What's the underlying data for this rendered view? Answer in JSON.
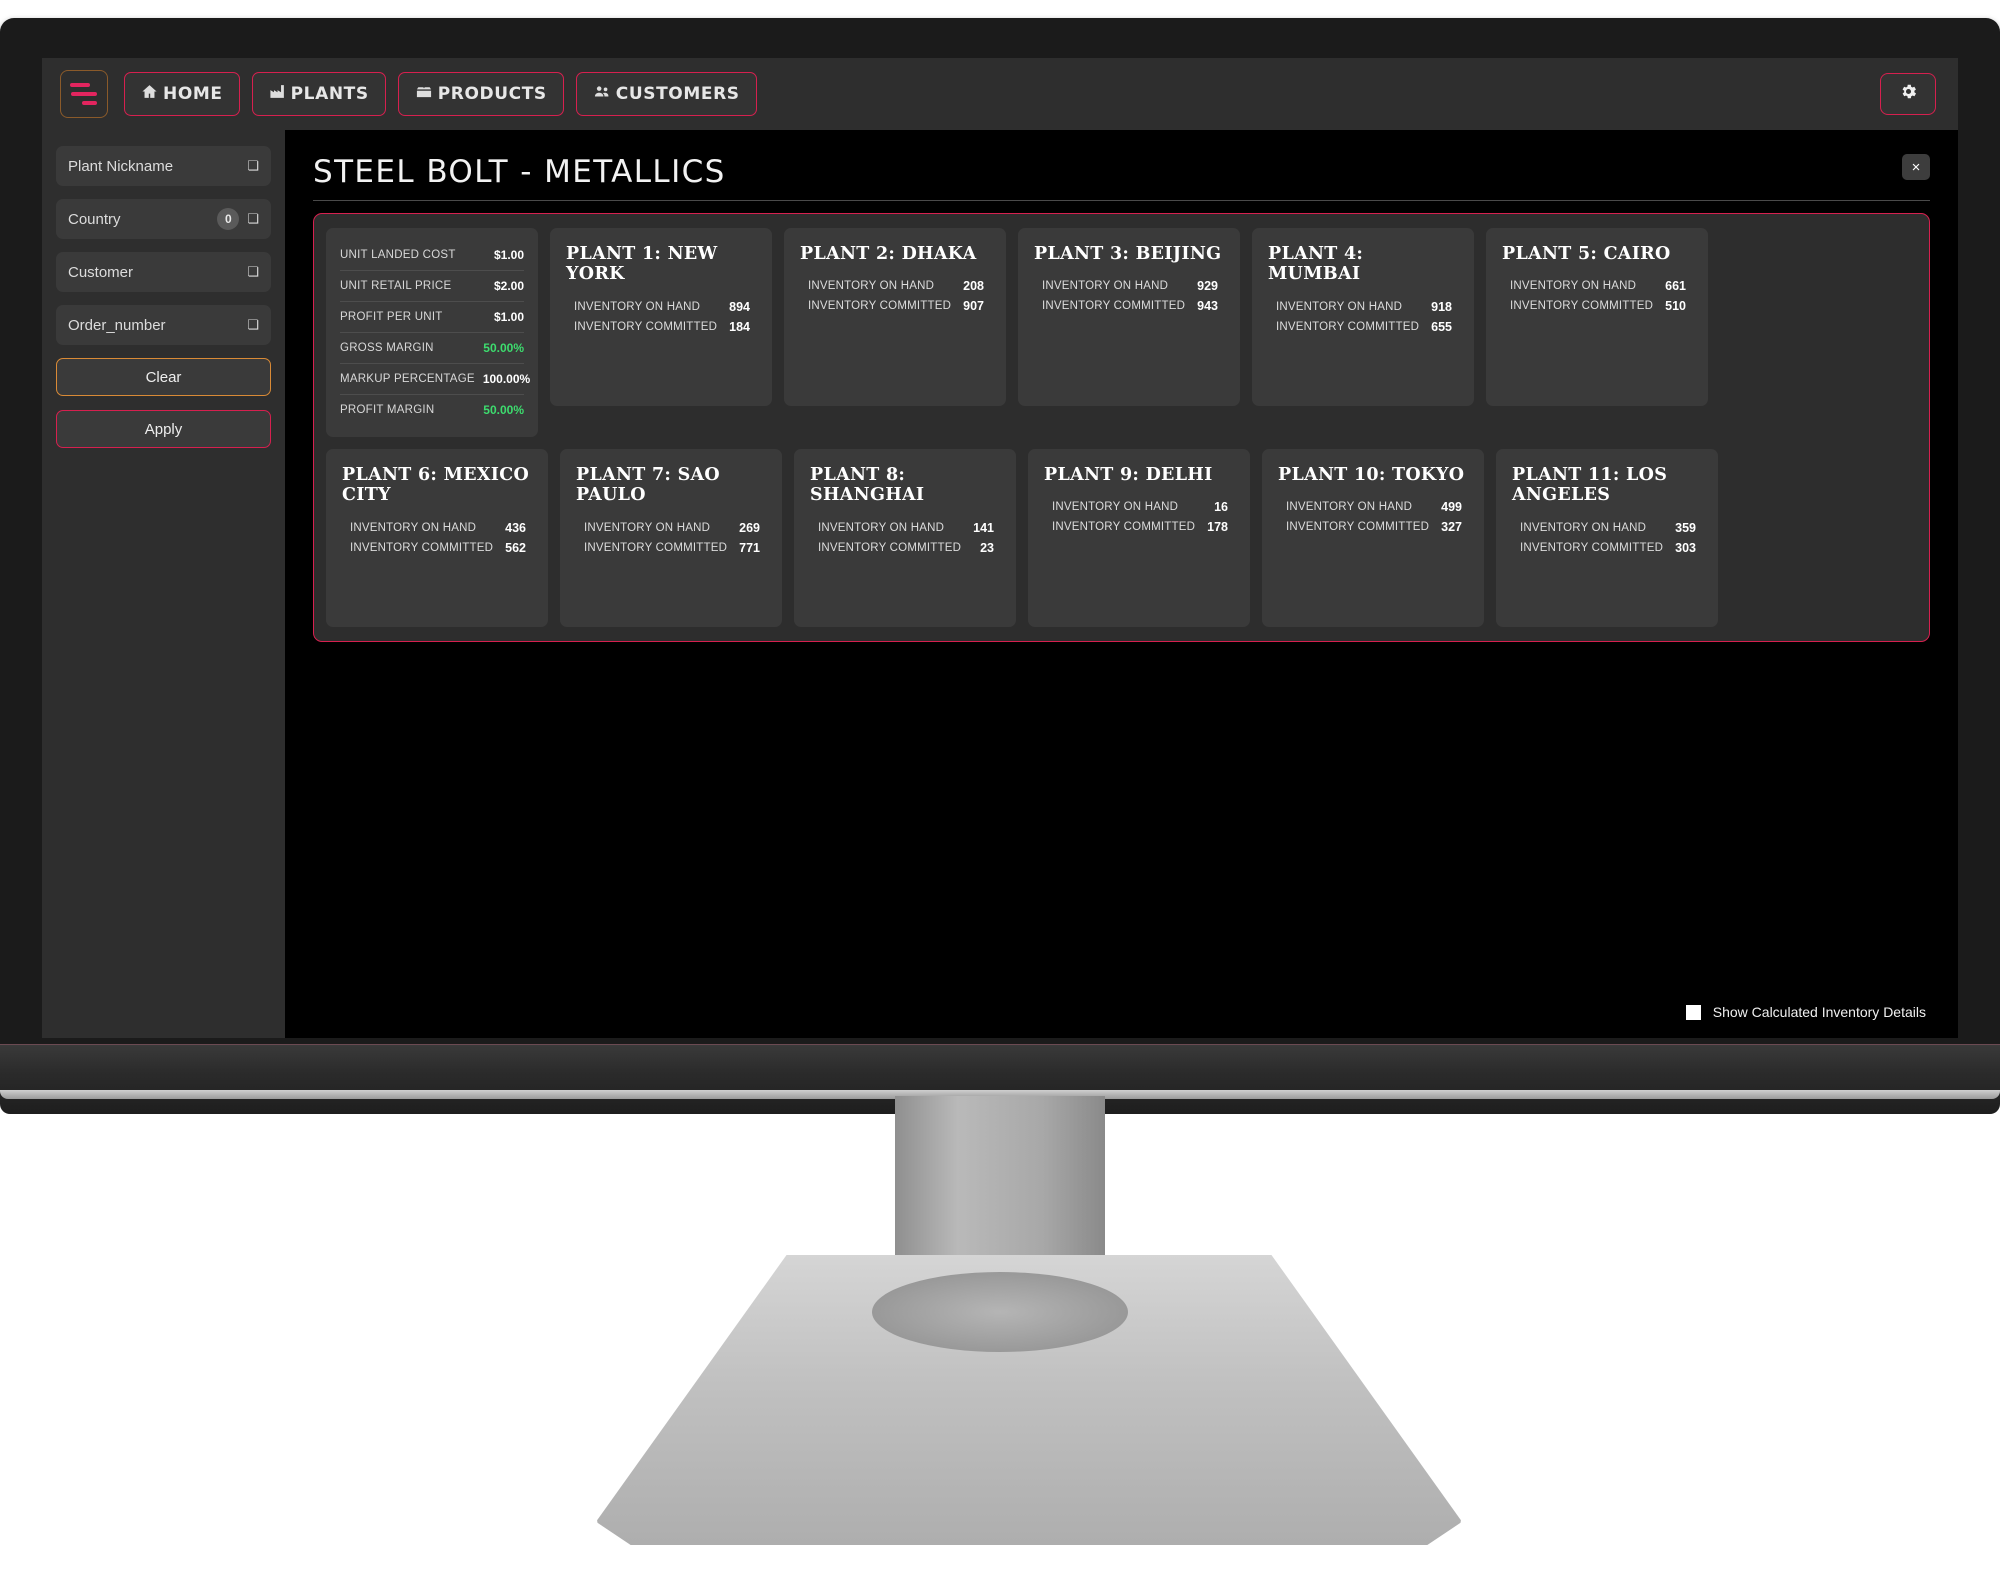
{
  "nav": {
    "brand_icon": "filter-menu-icon",
    "items": [
      {
        "label": "HOME",
        "icon": "home-icon"
      },
      {
        "label": "PLANTS",
        "icon": "factory-icon"
      },
      {
        "label": "PRODUCTS",
        "icon": "box-icon"
      },
      {
        "label": "CUSTOMERS",
        "icon": "people-icon"
      }
    ],
    "settings_icon": "gear-icon"
  },
  "sidebar": {
    "filters": [
      {
        "label": "Plant Nickname",
        "badge": null
      },
      {
        "label": "Country",
        "badge": "0"
      },
      {
        "label": "Customer",
        "badge": null
      },
      {
        "label": "Order_number",
        "badge": null
      }
    ],
    "clear_label": "Clear",
    "apply_label": "Apply"
  },
  "main": {
    "title": "STEEL BOLT - METALLICS",
    "close_label": "×",
    "metrics": [
      {
        "label": "UNIT LANDED COST",
        "value": "$1.00",
        "positive": false
      },
      {
        "label": "UNIT RETAIL PRICE",
        "value": "$2.00",
        "positive": false
      },
      {
        "label": "PROFIT PER UNIT",
        "value": "$1.00",
        "positive": false
      },
      {
        "label": "GROSS MARGIN",
        "value": "50.00%",
        "positive": true
      },
      {
        "label": "MARKUP PERCENTAGE",
        "value": "100.00%",
        "positive": false
      },
      {
        "label": "PROFIT MARGIN",
        "value": "50.00%",
        "positive": true
      }
    ],
    "inventory_on_hand_label": "INVENTORY ON HAND",
    "inventory_committed_label": "INVENTORY COMMITTED",
    "plants": [
      {
        "title": "PLANT 1: NEW YORK",
        "on_hand": "894",
        "committed": "184"
      },
      {
        "title": "PLANT 2: DHAKA",
        "on_hand": "208",
        "committed": "907"
      },
      {
        "title": "PLANT 3: BEIJING",
        "on_hand": "929",
        "committed": "943"
      },
      {
        "title": "PLANT 4: MUMBAI",
        "on_hand": "918",
        "committed": "655"
      },
      {
        "title": "PLANT 5: CAIRO",
        "on_hand": "661",
        "committed": "510"
      },
      {
        "title": "PLANT 6: MEXICO CITY",
        "on_hand": "436",
        "committed": "562"
      },
      {
        "title": "PLANT 7: SAO PAULO",
        "on_hand": "269",
        "committed": "771"
      },
      {
        "title": "PLANT 8: SHANGHAI",
        "on_hand": "141",
        "committed": "23"
      },
      {
        "title": "PLANT 9: DELHI",
        "on_hand": "16",
        "committed": "178"
      },
      {
        "title": "PLANT 10: TOKYO",
        "on_hand": "499",
        "committed": "327"
      },
      {
        "title": "PLANT 11: LOS ANGELES",
        "on_hand": "359",
        "committed": "303"
      }
    ],
    "show_details_label": "Show Calculated Inventory Details",
    "show_details_checked": false
  },
  "colors": {
    "accent_pink": "#d6204f",
    "accent_orange": "#d98a36",
    "positive_green": "#3ddc6e",
    "card_bg": "#3a3a3a",
    "panel_bg": "#2d2d2d",
    "chrome_bg": "#2e2e2e",
    "screen_bg": "#000000"
  }
}
